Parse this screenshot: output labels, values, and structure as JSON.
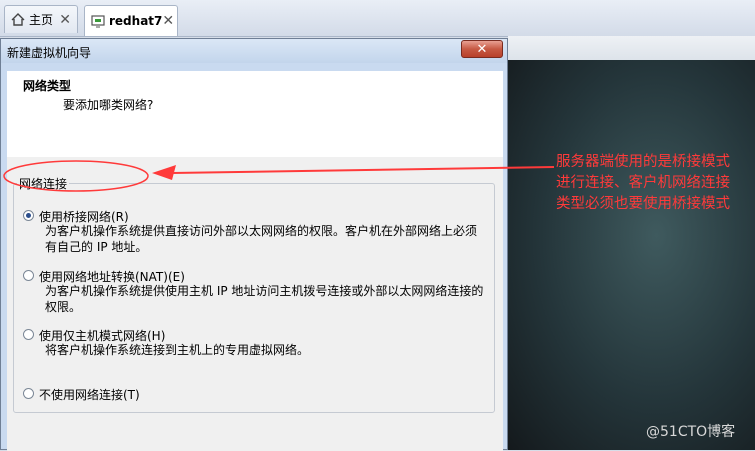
{
  "tabs": [
    {
      "label": "主页",
      "icon": "home-icon"
    },
    {
      "label": "redhat7",
      "icon": "vm-icon"
    }
  ],
  "dialog": {
    "title": "新建虚拟机向导",
    "header_title": "网络类型",
    "header_subtitle": "要添加哪类网络?",
    "group_label": "网络连接",
    "options": [
      {
        "label": "使用桥接网络(R)",
        "checked": true,
        "description": [
          "为客户机操作系统提供直接访问外部以太网网络的权限。客户机在外部网络上必须",
          "有自己的 IP 地址。"
        ]
      },
      {
        "label": "使用网络地址转换(NAT)(E)",
        "checked": false,
        "description": [
          "为客户机操作系统提供使用主机 IP 地址访问主机拨号连接或外部以太网网络连接的",
          "权限。"
        ]
      },
      {
        "label": "使用仅主机模式网络(H)",
        "checked": false,
        "description": [
          "将客户机操作系统连接到主机上的专用虚拟网络。"
        ]
      },
      {
        "label": "不使用网络连接(T)",
        "checked": false,
        "description": []
      }
    ]
  },
  "annotation": {
    "lines": [
      "服务器端使用的是桥接模式",
      "进行连接、客户机网络连接",
      "类型必须也要使用桥接模式"
    ],
    "color": "#ff3a3a"
  },
  "watermark": "@51CTO博客"
}
